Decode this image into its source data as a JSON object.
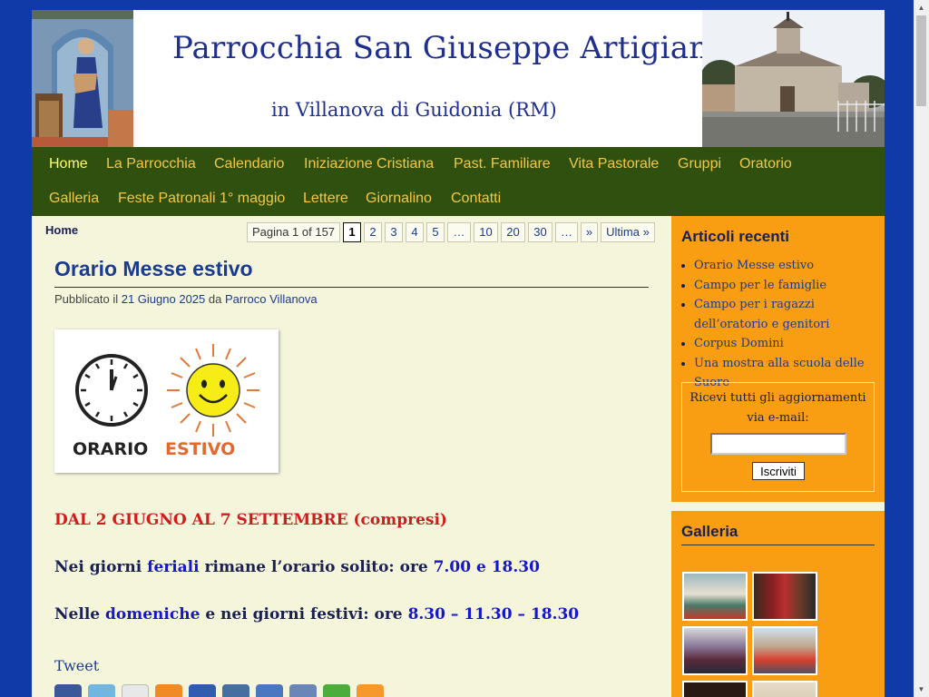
{
  "header": {
    "title": "Parrocchia San Giuseppe Artigiano",
    "subtitle": "in Villanova di Guidonia (RM)"
  },
  "nav": {
    "items": [
      {
        "label": "Home"
      },
      {
        "label": "La Parrocchia"
      },
      {
        "label": "Calendario"
      },
      {
        "label": "Iniziazione Cristiana"
      },
      {
        "label": "Past. Familiare"
      },
      {
        "label": "Vita Pastorale"
      },
      {
        "label": "Gruppi"
      },
      {
        "label": "Oratorio"
      },
      {
        "label": "Galleria"
      },
      {
        "label": "Feste Patronali 1° maggio"
      },
      {
        "label": "Lettere"
      },
      {
        "label": "Giornalino"
      },
      {
        "label": "Contatti"
      }
    ]
  },
  "breadcrumb": "Home",
  "pager": {
    "info": "Pagina 1 of 157",
    "pages": [
      "1",
      "2",
      "3",
      "4",
      "5",
      "…",
      "10",
      "20",
      "30",
      "…",
      "»",
      "Ultima »"
    ]
  },
  "post": {
    "title": "Orario Messe estivo",
    "meta_published": "Pubblicato il",
    "meta_date": "21 Giugno 2025",
    "meta_by": "da",
    "meta_author": "Parroco Villanova",
    "image_text_a": "ORARIO",
    "image_text_b": "ESTIVO",
    "line1": "DAL 2 GIUGNO AL 7 SETTEMBRE (compresi)",
    "line2": {
      "a": "Nei giorni",
      "b": "feriali",
      "c": "rimane l’orario solito: ore",
      "d": "7.00 e 18.30"
    },
    "line3": {
      "a": "Nelle",
      "b": "domeniche",
      "c": "e nei giorni festivi: ore",
      "d": "8.30 – 11.30 – 18.30"
    },
    "tweet": "Tweet"
  },
  "share_icons": [
    "facebook-icon",
    "twitter-icon",
    "email-icon",
    "blogger-icon",
    "delicious-icon",
    "digg-icon",
    "google-icon",
    "myspace-icon",
    "evernote-icon",
    "rss-icon"
  ],
  "sidebar": {
    "recent_title": "Articoli recenti",
    "recent": [
      "Orario Messe estivo",
      "Campo per le famiglie",
      "Campo per i ragazzi dell’oratorio e genitori",
      "Corpus Domini",
      "Una mostra alla scuola delle Suore"
    ],
    "subscribe_label": "Ricevi tutti gli aggiornamenti via e-mail:",
    "subscribe_value": "",
    "subscribe_button": "Iscriviti",
    "gallery_title": "Galleria"
  },
  "colors": {
    "background": "#0f3aa8",
    "nav_bg": "#305010",
    "nav_text": "#f3c840",
    "sidebar_bg": "#f99d12",
    "content_bg": "#f5f5dc"
  }
}
